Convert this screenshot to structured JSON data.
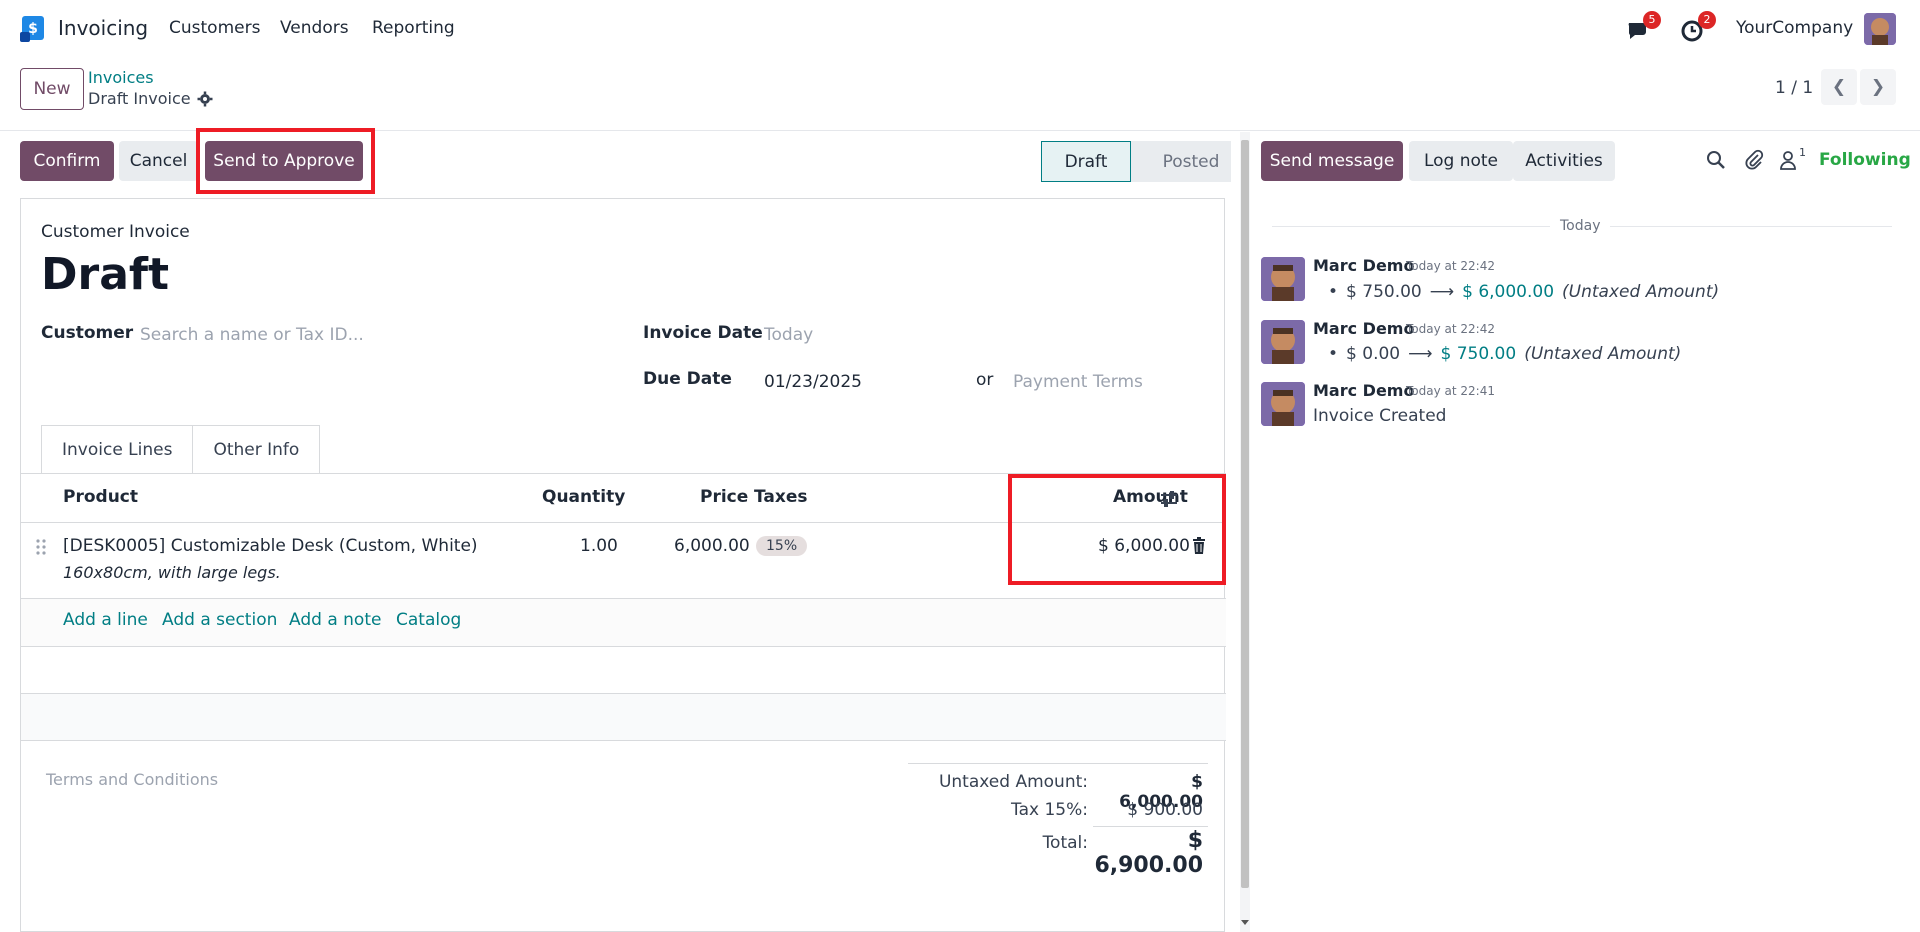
{
  "navbar": {
    "app_name": "Invoicing",
    "menu": [
      "Customers",
      "Vendors",
      "Reporting"
    ],
    "messages_count": "5",
    "activities_count": "2",
    "company": "YourCompany"
  },
  "control": {
    "new_label": "New",
    "breadcrumb_parent": "Invoices",
    "breadcrumb_current": "Draft Invoice",
    "pager": "1 / 1"
  },
  "actions": {
    "confirm": "Confirm",
    "cancel": "Cancel",
    "send_to_approve": "Send to Approve"
  },
  "status": {
    "draft": "Draft",
    "posted": "Posted"
  },
  "form": {
    "type_label": "Customer Invoice",
    "title": "Draft",
    "customer_label": "Customer",
    "customer_placeholder": "Search a name or Tax ID...",
    "invoice_date_label": "Invoice Date",
    "invoice_date_placeholder": "Today",
    "due_date_label": "Due Date",
    "due_date_value": "01/23/2025",
    "or_label": "or",
    "payment_terms_placeholder": "Payment Terms",
    "tabs": [
      "Invoice Lines",
      "Other Info"
    ]
  },
  "lines": {
    "headers": {
      "product": "Product",
      "quantity": "Quantity",
      "price": "Price",
      "taxes": "Taxes",
      "amount": "Amount"
    },
    "rows": [
      {
        "product": "[DESK0005] Customizable Desk (Custom, White)",
        "description": "160x80cm, with large legs.",
        "quantity": "1.00",
        "price": "6,000.00",
        "tax": "15%",
        "amount": "$ 6,000.00"
      }
    ],
    "add_links": [
      "Add a line",
      "Add a section",
      "Add a note",
      "Catalog"
    ]
  },
  "footer": {
    "terms_placeholder": "Terms and Conditions",
    "untaxed_label": "Untaxed Amount:",
    "untaxed_value": "$ 6,000.00",
    "tax_label": "Tax 15%:",
    "tax_value": "$ 900.00",
    "total_label": "Total:",
    "total_value": "$ 6,900.00"
  },
  "chatter": {
    "send_message": "Send message",
    "log_note": "Log note",
    "activities": "Activities",
    "followers_count": "1",
    "following": "Following",
    "date_separator": "Today",
    "messages": [
      {
        "author": "Marc Demo",
        "time": "Today at 22:42",
        "from": "$ 750.00",
        "to": "$ 6,000.00",
        "field": "(Untaxed Amount)"
      },
      {
        "author": "Marc Demo",
        "time": "Today at 22:42",
        "from": "$ 0.00",
        "to": "$ 750.00",
        "field": "(Untaxed Amount)"
      },
      {
        "author": "Marc Demo",
        "time": "Today at 22:41",
        "text": "Invoice Created"
      }
    ]
  },
  "colors": {
    "primary": "#714b67",
    "link": "#017e84",
    "highlight": "#ee1c25",
    "badge": "#dc2626"
  }
}
